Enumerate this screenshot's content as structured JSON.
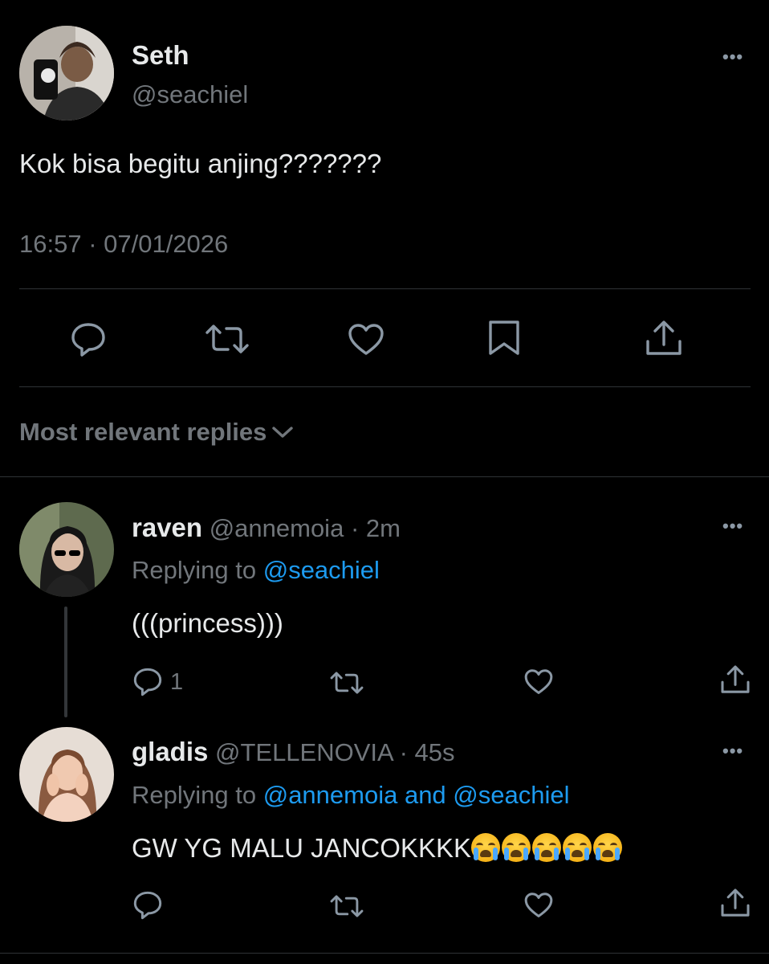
{
  "tweet": {
    "author_name": "Seth",
    "author_handle": "@seachiel",
    "text": "Kok bisa begitu anjing???????",
    "timestamp": "16:57 · 07/01/2026",
    "more_icon": "more-horizontal-icon",
    "actions": [
      "reply-icon",
      "retweet-icon",
      "like-icon",
      "bookmark-icon",
      "share-icon"
    ]
  },
  "replies_filter": {
    "label": "Most relevant replies",
    "icon": "chevron-down-icon"
  },
  "replies": [
    {
      "name": "raven",
      "handle": "@annemoia",
      "time": "· 2m",
      "replying_prefix": "Replying to",
      "replying_to": "@seachiel",
      "text": "(((princess)))",
      "reply_count": "1"
    },
    {
      "name": "gladis",
      "handle": "@TELLENOVIA",
      "time": "· 45s",
      "replying_prefix": "Replying to",
      "replying_to": "@annemoia and @seachiel",
      "text": "GW YG MALU JANCOKKKK",
      "emoji": "loudly-crying-face-emoji",
      "emoji_count": 5,
      "reply_count": ""
    }
  ],
  "colors": {
    "background": "#000000",
    "text": "#e7e9ea",
    "secondary": "#71767b",
    "accent": "#1d9bf0",
    "divider": "#2f3336"
  }
}
